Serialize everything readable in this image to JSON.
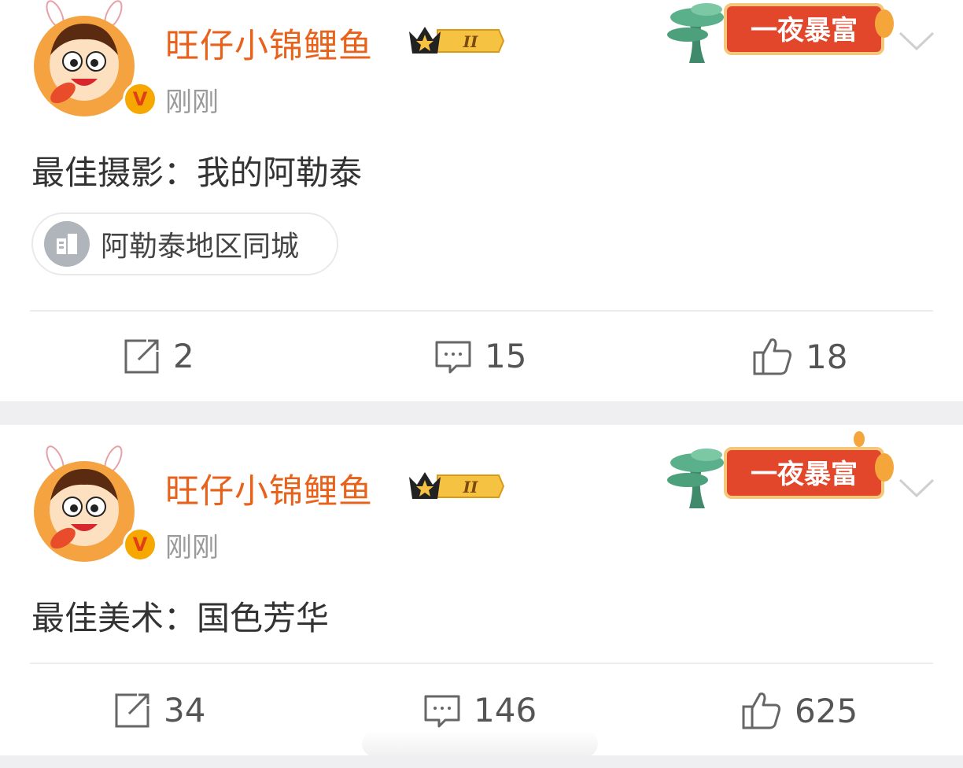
{
  "posts": [
    {
      "username": "旺仔小锦鲤鱼",
      "vip_level": "II",
      "verified_mark": "V",
      "time": "刚刚",
      "banner_text": "一夜暴富",
      "content": "最佳摄影：我的阿勒泰",
      "location": "阿勒泰地区同城",
      "reposts": "2",
      "comments": "15",
      "likes": "18"
    },
    {
      "username": "旺仔小锦鲤鱼",
      "vip_level": "II",
      "verified_mark": "V",
      "time": "刚刚",
      "banner_text": "一夜暴富",
      "content": "最佳美术：国色芳华",
      "reposts": "34",
      "comments": "146",
      "likes": "625"
    }
  ],
  "colors": {
    "username": "#e8621b",
    "banner_red": "#e2472b",
    "banner_gold": "#f4c77a",
    "separator": "#efeff1",
    "verified_badge": "#f6a800"
  },
  "icons": [
    "avatar-mascot",
    "verified-badge",
    "vip-crown-icon",
    "chevron-down-icon",
    "location-building-icon",
    "repost-icon",
    "comment-icon",
    "like-icon"
  ]
}
